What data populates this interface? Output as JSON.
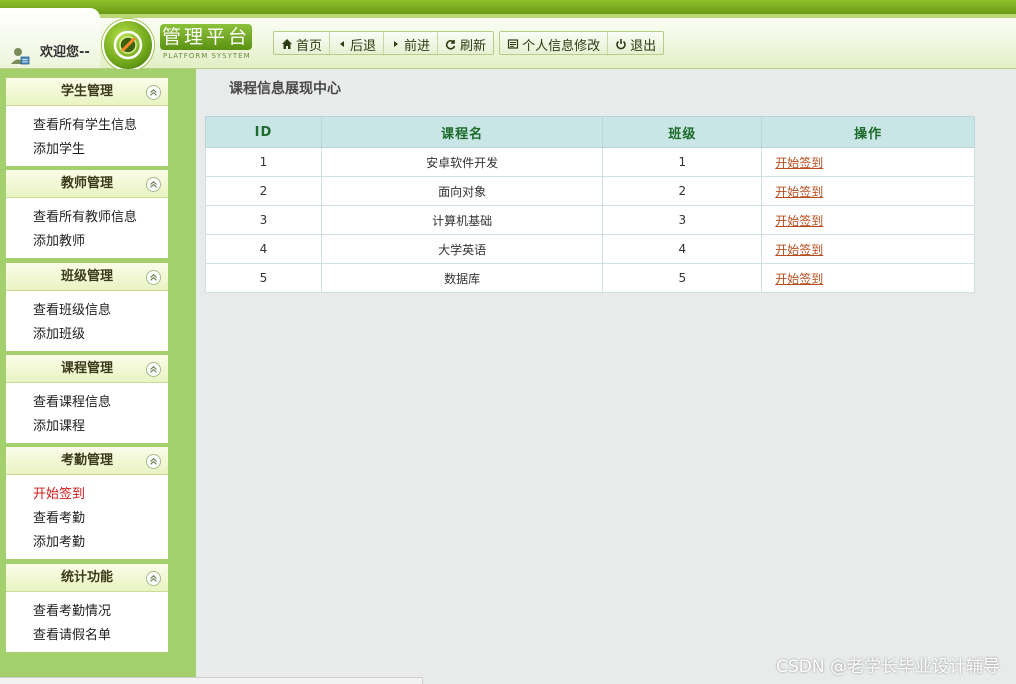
{
  "header": {
    "welcome": "欢迎您--",
    "logo_title": "管理平台",
    "logo_subtitle": "PLATFORM SYSYTEM",
    "nav": [
      {
        "label": "首页",
        "icon": "home-icon"
      },
      {
        "label": "后退",
        "icon": "back-icon"
      },
      {
        "label": "前进",
        "icon": "forward-icon"
      },
      {
        "label": "刷新",
        "icon": "refresh-icon"
      }
    ],
    "nav2": [
      {
        "label": "个人信息修改",
        "icon": "profile-icon"
      },
      {
        "label": "退出",
        "icon": "power-icon"
      }
    ]
  },
  "sidebar": {
    "panels": [
      {
        "title": "学生管理",
        "items": [
          "查看所有学生信息",
          "添加学生"
        ]
      },
      {
        "title": "教师管理",
        "items": [
          "查看所有教师信息",
          "添加教师"
        ]
      },
      {
        "title": "班级管理",
        "items": [
          "查看班级信息",
          "添加班级"
        ]
      },
      {
        "title": "课程管理",
        "items": [
          "查看课程信息",
          "添加课程"
        ]
      },
      {
        "title": "考勤管理",
        "items": [
          "开始签到",
          "查看考勤",
          "添加考勤"
        ]
      },
      {
        "title": "统计功能",
        "items": [
          "查看考勤情况",
          "查看请假名单"
        ]
      }
    ]
  },
  "main": {
    "title": "课程信息展现中心",
    "columns": [
      "ID",
      "课程名",
      "班级",
      "操作"
    ],
    "rows": [
      {
        "id": "1",
        "name": "安卓软件开发",
        "class": "1",
        "action": "开始签到"
      },
      {
        "id": "2",
        "name": "面向对象",
        "class": "2",
        "action": "开始签到"
      },
      {
        "id": "3",
        "name": "计算机基础",
        "class": "3",
        "action": "开始签到"
      },
      {
        "id": "4",
        "name": "大学英语",
        "class": "4",
        "action": "开始签到"
      },
      {
        "id": "5",
        "name": "数据库",
        "class": "5",
        "action": "开始签到"
      }
    ]
  },
  "watermark": "CSDN @老学长毕业设计辅导",
  "colors": {
    "sidebar_bg": "#a3cf6d",
    "header_green": "#6a9a14",
    "link": "#b54d1e",
    "active": "#d01a1a",
    "table_head": "#c9e5e6"
  }
}
